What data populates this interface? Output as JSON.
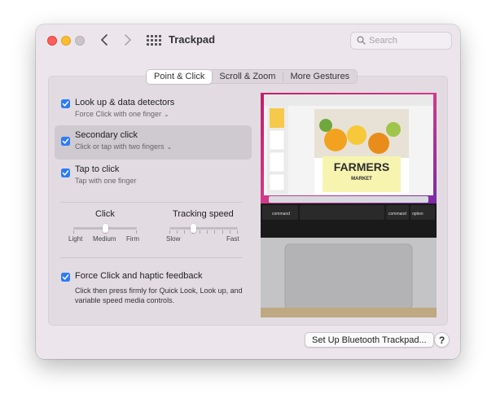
{
  "window": {
    "title": "Trackpad",
    "search_placeholder": "Search"
  },
  "tabs": [
    {
      "label": "Point & Click",
      "active": true
    },
    {
      "label": "Scroll & Zoom",
      "active": false
    },
    {
      "label": "More Gestures",
      "active": false
    }
  ],
  "options": [
    {
      "title": "Look up & data detectors",
      "subtitle": "Force Click with one finger",
      "checked": true,
      "has_dropdown": true,
      "highlighted": false
    },
    {
      "title": "Secondary click",
      "subtitle": "Click or tap with two fingers",
      "checked": true,
      "has_dropdown": true,
      "highlighted": true
    },
    {
      "title": "Tap to click",
      "subtitle": "Tap with one finger",
      "checked": true,
      "has_dropdown": false,
      "highlighted": false
    }
  ],
  "sliders": {
    "click": {
      "title": "Click",
      "labels": [
        "Light",
        "Medium",
        "Firm"
      ],
      "value": "Medium"
    },
    "tracking": {
      "title": "Tracking speed",
      "min_label": "Slow",
      "max_label": "Fast",
      "value": 0.35,
      "ticks": 10
    }
  },
  "force_click": {
    "title": "Force Click and haptic feedback",
    "checked": true,
    "description": "Click then press firmly for Quick Look, Look up, and variable speed media controls."
  },
  "preview": {
    "headline": "FARMERS",
    "subhead": "MARKET",
    "keyboard_labels": [
      "command",
      "command",
      "option"
    ]
  },
  "buttons": {
    "setup_bluetooth": "Set Up Bluetooth Trackpad...",
    "help": "?"
  },
  "colors": {
    "accent": "#2d7cf6",
    "window_bg": "#ece6ec",
    "panel_bg": "#e2dce2"
  }
}
